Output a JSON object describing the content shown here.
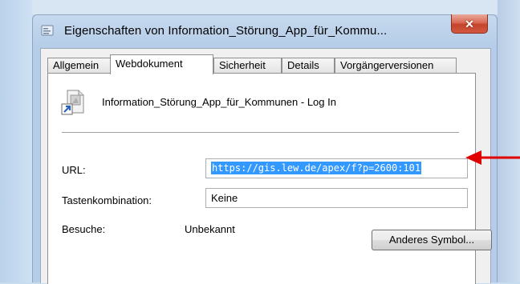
{
  "window": {
    "title": "Eigenschaften von Information_Störung_App_für_Kommu..."
  },
  "tabs": [
    {
      "label": "Allgemein"
    },
    {
      "label": "Webdokument",
      "active": true
    },
    {
      "label": "Sicherheit"
    },
    {
      "label": "Details"
    },
    {
      "label": "Vorgängerversionen"
    }
  ],
  "document": {
    "name": "Information_Störung_App_für_Kommunen - Log In",
    "icon": "internet-shortcut-icon"
  },
  "fields": {
    "url_label": "URL:",
    "url_value": "https://gis.lew.de/apex/f?p=2600:101",
    "shortcut_label": "Tastenkombination:",
    "shortcut_value": "Keine",
    "visits_label": "Besuche:",
    "visits_value": "Unbekannt"
  },
  "buttons": {
    "change_icon": "Anderes Symbol..."
  },
  "colors": {
    "selection": "#3399ff",
    "annotation_arrow": "#e00000",
    "close_button": "#c4432b"
  }
}
